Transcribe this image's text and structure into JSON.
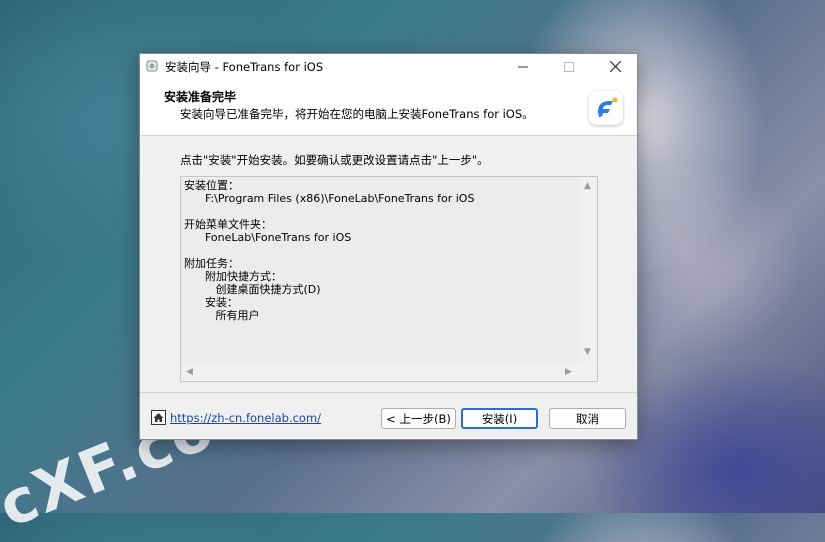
{
  "watermark": "cXF.co",
  "window": {
    "title": "安装向导 - FoneTrans for iOS",
    "controls": {
      "minimize": "—",
      "maximize": "☐",
      "close": "✕"
    }
  },
  "header": {
    "title": "安装准备完毕",
    "subtitle": "安装向导已准备完毕，将开始在您的电脑上安装FoneTrans for iOS。",
    "logo_icon": "fonetrans-logo-icon"
  },
  "intro": "点击\"安装\"开始安装。如要确认或更改设置请点击\"上一步\"。",
  "memo": {
    "lines": [
      "安装位置：",
      "      F:\\Program Files (x86)\\FoneLab\\FoneTrans for iOS",
      "",
      "开始菜单文件夹：",
      "      FoneLab\\FoneTrans for iOS",
      "",
      "附加任务：",
      "      附加快捷方式：",
      "         创建桌面快捷方式(D)",
      "      安装：",
      "         所有用户"
    ]
  },
  "footer": {
    "url": "https://zh-cn.fonelab.com/",
    "back_label": "< 上一步(B)",
    "install_label": "安装(I)",
    "cancel_label": "取消"
  },
  "colors": {
    "accent": "#2f6fc8",
    "link": "#1a46a8"
  }
}
